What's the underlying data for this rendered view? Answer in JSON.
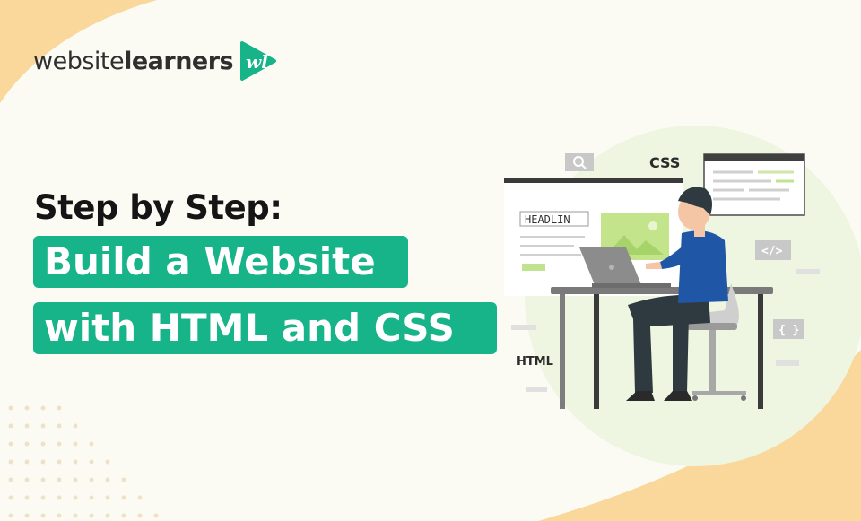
{
  "logo": {
    "word1": "website",
    "word2": "learners",
    "mark": "wl"
  },
  "heading": "Step by Step:",
  "highlight_lines": [
    "Build a Website",
    "with HTML and CSS"
  ],
  "illustration": {
    "css_label": "CSS",
    "html_label": "HTML",
    "headline_text": "HEADLIN",
    "code_tag_icon": "</>",
    "braces_icon": "{ }"
  },
  "colors": {
    "accent": "#17b389",
    "bg": "#fbfbf3",
    "wave": "#fad79a",
    "shirt": "#1f57a6"
  }
}
